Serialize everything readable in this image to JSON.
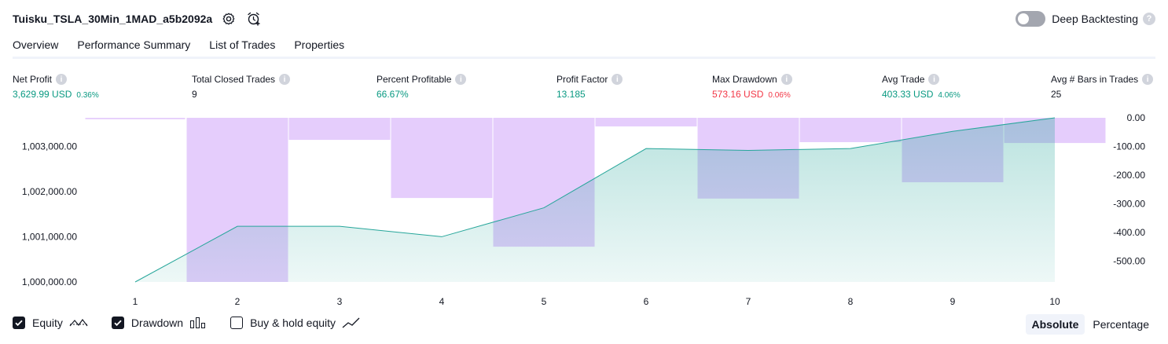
{
  "header": {
    "strategy_name": "Tuisku_TSLA_30Min_1MAD_a5b2092a",
    "settings_icon": "gear-icon",
    "alert_icon": "alarm-add-icon",
    "deep_backtesting_label": "Deep Backtesting",
    "deep_backtesting_enabled": false,
    "help_glyph": "?"
  },
  "tabs": [
    {
      "label": "Overview",
      "active": true
    },
    {
      "label": "Performance Summary",
      "active": false
    },
    {
      "label": "List of Trades",
      "active": false
    },
    {
      "label": "Properties",
      "active": false
    }
  ],
  "metrics": {
    "info_glyph": "i",
    "net_profit": {
      "label": "Net Profit",
      "value": "3,629.99 USD",
      "pct": "0.36%"
    },
    "total_closed_trades": {
      "label": "Total Closed Trades",
      "value": "9"
    },
    "percent_profitable": {
      "label": "Percent Profitable",
      "value": "66.67%"
    },
    "profit_factor": {
      "label": "Profit Factor",
      "value": "13.185"
    },
    "max_drawdown": {
      "label": "Max Drawdown",
      "value": "573.16 USD",
      "pct": "0.06%"
    },
    "avg_trade": {
      "label": "Avg Trade",
      "value": "403.33 USD",
      "pct": "4.06%"
    },
    "avg_bars": {
      "label": "Avg # Bars in Trades",
      "value": "25"
    }
  },
  "colors": {
    "green": "#089981",
    "red": "#f23645",
    "equity_line": "#26a69a",
    "drawdown_bar": "#e1c4fc"
  },
  "chart_data": {
    "type": "line",
    "x": [
      1,
      2,
      3,
      4,
      5,
      6,
      7,
      8,
      9,
      10
    ],
    "x_tick_labels": [
      "1",
      "2",
      "3",
      "4",
      "5",
      "6",
      "7",
      "8",
      "9",
      "10"
    ],
    "left_axis": {
      "ticks": [
        1000000,
        1001000,
        1002000,
        1003000
      ],
      "tick_labels": [
        "1,000,000.00",
        "1,001,000.00",
        "1,002,000.00",
        "1,003,000.00"
      ],
      "ylim": [
        1000000,
        1003630
      ]
    },
    "right_axis": {
      "ticks": [
        0,
        -100,
        -200,
        -300,
        -400,
        -500
      ],
      "tick_labels": [
        "0.00",
        "-100.00",
        "-200.00",
        "-300.00",
        "-400.00",
        "-500.00"
      ],
      "ylim": [
        -573.16,
        0
      ]
    },
    "series": [
      {
        "kind": "area-line",
        "axis": "left",
        "values": [
          1000000,
          1001230,
          1001230,
          1001000,
          1001640,
          1002950,
          1002910,
          1002950,
          1003330,
          1003630
        ]
      },
      {
        "kind": "bar",
        "axis": "right",
        "x": [
          0,
          2,
          3,
          4,
          5,
          6,
          7,
          8,
          9,
          10
        ],
        "values": [
          -5,
          -573.16,
          -77,
          -280,
          -450,
          -30,
          -282,
          -85,
          -225,
          -88
        ]
      }
    ]
  },
  "legend": {
    "equity": {
      "label": "Equity",
      "checked": true,
      "icon": "equity-line-icon"
    },
    "drawdown": {
      "label": "Drawdown",
      "checked": true,
      "icon": "bar-chart-icon"
    },
    "buy_hold": {
      "label": "Buy & hold equity",
      "checked": false,
      "icon": "trend-line-icon"
    }
  },
  "modes": {
    "absolute": "Absolute",
    "percentage": "Percentage",
    "selected": "absolute"
  }
}
